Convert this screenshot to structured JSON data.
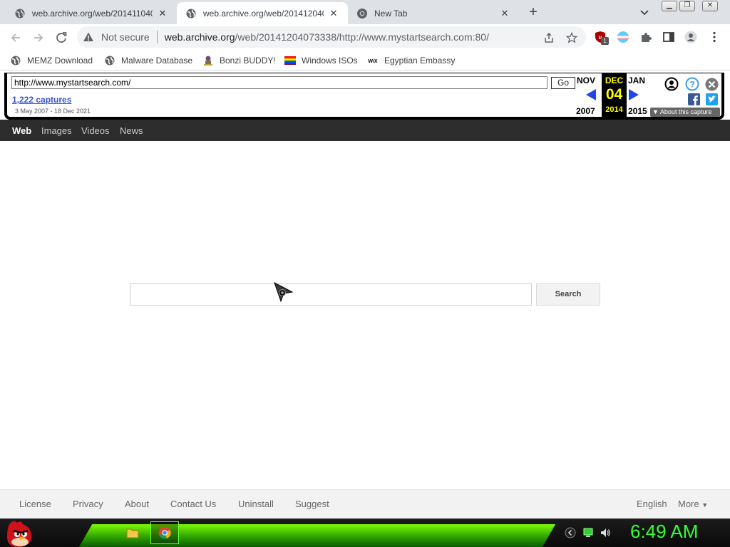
{
  "browser": {
    "tabs": [
      {
        "title": "web.archive.org/web/201411040",
        "active": false
      },
      {
        "title": "web.archive.org/web/201412040",
        "active": true
      },
      {
        "title": "New Tab",
        "active": false
      }
    ],
    "security_label": "Not secure",
    "url_host": "web.archive.org",
    "url_path": "/web/20141204073338/http://www.mystartsearch.com:80/",
    "extension_badge": "1"
  },
  "bookmarks": [
    {
      "label": "MEMZ Download",
      "icon": "globe-icon"
    },
    {
      "label": "Malware Database",
      "icon": "globe-icon"
    },
    {
      "label": "Bonzi BUDDY!",
      "icon": "bonzi-icon"
    },
    {
      "label": "Windows ISOs",
      "icon": "rainbow-flag-icon"
    },
    {
      "label": "Egyptian Embassy",
      "icon": "wix-icon"
    }
  ],
  "wayback": {
    "url_value": "http://www.mystartsearch.com/",
    "go_label": "Go",
    "captures_label": "1,222 captures",
    "range_label": "3 May 2007 - 18 Dec 2021",
    "prev_month": "NOV",
    "prev_year": "2007",
    "cur_month": "DEC",
    "cur_day": "04",
    "cur_year": "2014",
    "next_month": "JAN",
    "next_year": "2015",
    "about_label": "About this capture"
  },
  "site": {
    "nav": [
      "Web",
      "Images",
      "Videos",
      "News"
    ],
    "search_value": "",
    "search_button": "Search",
    "footer_links": [
      "License",
      "Privacy",
      "About",
      "Contact Us",
      "Uninstall",
      "Suggest"
    ],
    "language": "English",
    "more": "More"
  },
  "taskbar": {
    "clock": "6:49 AM"
  },
  "colors": {
    "wayback_highlight": "#ffff00",
    "wayback_link": "#3355cc",
    "site_nav_bg": "#2d2d2d",
    "taskbar_green": "#33ff33"
  }
}
